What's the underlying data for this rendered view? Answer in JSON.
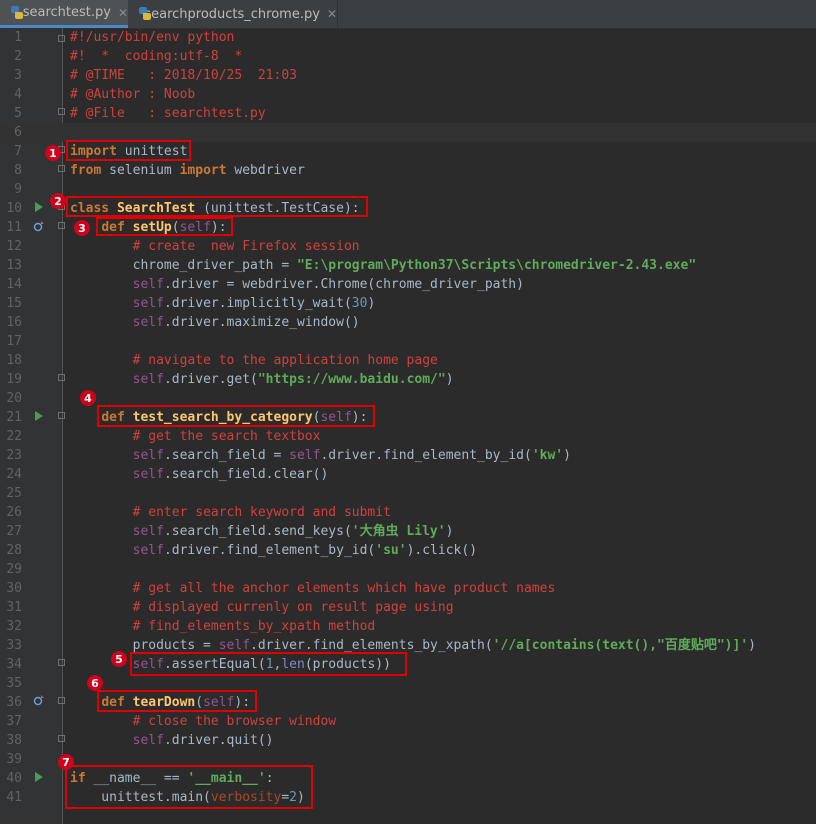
{
  "tabs": [
    {
      "label": "searchtest.py",
      "close": "✕",
      "active": true
    },
    {
      "label": "searchproducts_chrome.py",
      "close": "✕",
      "active": false
    }
  ],
  "editor": {
    "current_line": 6,
    "lines": [
      {
        "n": "1",
        "t": [
          [
            "cmt",
            "#!/usr/bin/env python"
          ]
        ]
      },
      {
        "n": "2",
        "t": [
          [
            "cmt",
            "#!  *  coding:utf-8  *"
          ]
        ]
      },
      {
        "n": "3",
        "t": [
          [
            "cmt",
            "# @TIME   : 2018/10/25  21:03"
          ]
        ]
      },
      {
        "n": "4",
        "t": [
          [
            "cmt",
            "# @Author : Noob"
          ]
        ]
      },
      {
        "n": "5",
        "t": [
          [
            "cmt",
            "# @File   : searchtest.py"
          ]
        ]
      },
      {
        "n": "6",
        "t": []
      },
      {
        "n": "7",
        "t": [
          [
            "kw",
            "import"
          ],
          [
            "p",
            " unittest"
          ]
        ]
      },
      {
        "n": "8",
        "t": [
          [
            "kw",
            "from"
          ],
          [
            "p",
            " selenium "
          ],
          [
            "kw",
            "import"
          ],
          [
            "p",
            " webdriver"
          ]
        ]
      },
      {
        "n": "9",
        "t": []
      },
      {
        "n": "10",
        "t": [
          [
            "kw",
            "class"
          ],
          [
            "p",
            " "
          ],
          [
            "fnm",
            "SearchTest"
          ],
          [
            "p",
            " (unittest.TestCase):"
          ]
        ]
      },
      {
        "n": "11",
        "t": [
          [
            "p",
            "    "
          ],
          [
            "kw",
            "def"
          ],
          [
            "p",
            " "
          ],
          [
            "fnm",
            "setUp"
          ],
          [
            "p",
            "("
          ],
          [
            "slf",
            "self"
          ],
          [
            "p",
            "):"
          ]
        ]
      },
      {
        "n": "12",
        "t": [
          [
            "p",
            "        "
          ],
          [
            "cmt",
            "# create  new Firefox session"
          ]
        ]
      },
      {
        "n": "13",
        "t": [
          [
            "p",
            "        chrome_driver_path = "
          ],
          [
            "str",
            "\"E:\\program\\Python37\\Scripts\\chromedriver-2.43.exe\""
          ]
        ]
      },
      {
        "n": "14",
        "t": [
          [
            "p",
            "        "
          ],
          [
            "slf",
            "self"
          ],
          [
            "p",
            ".driver = webdriver.Chrome(chrome_driver_path)"
          ]
        ]
      },
      {
        "n": "15",
        "t": [
          [
            "p",
            "        "
          ],
          [
            "slf",
            "self"
          ],
          [
            "p",
            ".driver.implicitly_wait("
          ],
          [
            "num",
            "30"
          ],
          [
            "p",
            ")"
          ]
        ]
      },
      {
        "n": "16",
        "t": [
          [
            "p",
            "        "
          ],
          [
            "slf",
            "self"
          ],
          [
            "p",
            ".driver.maximize_window()"
          ]
        ]
      },
      {
        "n": "17",
        "t": []
      },
      {
        "n": "18",
        "t": [
          [
            "p",
            "        "
          ],
          [
            "cmt",
            "# navigate to the application home page"
          ]
        ]
      },
      {
        "n": "19",
        "t": [
          [
            "p",
            "        "
          ],
          [
            "slf",
            "self"
          ],
          [
            "p",
            ".driver.get("
          ],
          [
            "str",
            "\"https://www.baidu.com/\""
          ],
          [
            "p",
            ")"
          ]
        ]
      },
      {
        "n": "20",
        "t": []
      },
      {
        "n": "21",
        "t": [
          [
            "p",
            "    "
          ],
          [
            "kw",
            "def"
          ],
          [
            "p",
            " "
          ],
          [
            "fnm",
            "test_search_by_category"
          ],
          [
            "p",
            "("
          ],
          [
            "slf",
            "self"
          ],
          [
            "p",
            "):"
          ]
        ]
      },
      {
        "n": "22",
        "t": [
          [
            "p",
            "        "
          ],
          [
            "cmt",
            "# get the search textbox"
          ]
        ]
      },
      {
        "n": "23",
        "t": [
          [
            "p",
            "        "
          ],
          [
            "slf",
            "self"
          ],
          [
            "p",
            ".search_field = "
          ],
          [
            "slf",
            "self"
          ],
          [
            "p",
            ".driver.find_element_by_id("
          ],
          [
            "str",
            "'kw'"
          ],
          [
            "p",
            ")"
          ]
        ]
      },
      {
        "n": "24",
        "t": [
          [
            "p",
            "        "
          ],
          [
            "slf",
            "self"
          ],
          [
            "p",
            ".search_field.clear()"
          ]
        ]
      },
      {
        "n": "25",
        "t": []
      },
      {
        "n": "26",
        "t": [
          [
            "p",
            "        "
          ],
          [
            "cmt",
            "# enter search keyword and submit"
          ]
        ]
      },
      {
        "n": "27",
        "t": [
          [
            "p",
            "        "
          ],
          [
            "slf",
            "self"
          ],
          [
            "p",
            ".search_field.send_keys("
          ],
          [
            "str",
            "'大角虫 Lily'"
          ],
          [
            "p",
            ")"
          ]
        ]
      },
      {
        "n": "28",
        "t": [
          [
            "p",
            "        "
          ],
          [
            "slf",
            "self"
          ],
          [
            "p",
            ".driver.find_element_by_id("
          ],
          [
            "str",
            "'su'"
          ],
          [
            "p",
            ").click()"
          ]
        ]
      },
      {
        "n": "29",
        "t": []
      },
      {
        "n": "30",
        "t": [
          [
            "p",
            "        "
          ],
          [
            "cmt",
            "# get all the anchor elements which have product names"
          ]
        ]
      },
      {
        "n": "31",
        "t": [
          [
            "p",
            "        "
          ],
          [
            "cmt",
            "# displayed currenly on result page using"
          ]
        ]
      },
      {
        "n": "32",
        "t": [
          [
            "p",
            "        "
          ],
          [
            "cmt",
            "# find_elements_by_xpath method"
          ]
        ]
      },
      {
        "n": "33",
        "t": [
          [
            "p",
            "        products = "
          ],
          [
            "slf",
            "self"
          ],
          [
            "p",
            ".driver.find_elements_by_xpath("
          ],
          [
            "str",
            "'//a[contains(text(),\"百度贴吧\")]'"
          ],
          [
            "p",
            ")"
          ]
        ]
      },
      {
        "n": "34",
        "t": [
          [
            "p",
            "        "
          ],
          [
            "slf",
            "self"
          ],
          [
            "p",
            ".assertEqual("
          ],
          [
            "num",
            "1"
          ],
          [
            "p",
            ","
          ],
          [
            "bi",
            "len"
          ],
          [
            "p",
            "(products))"
          ]
        ]
      },
      {
        "n": "35",
        "t": []
      },
      {
        "n": "36",
        "t": [
          [
            "p",
            "    "
          ],
          [
            "kw",
            "def"
          ],
          [
            "p",
            " "
          ],
          [
            "fnm",
            "tearDown"
          ],
          [
            "p",
            "("
          ],
          [
            "slf",
            "self"
          ],
          [
            "p",
            "):"
          ]
        ]
      },
      {
        "n": "37",
        "t": [
          [
            "p",
            "        "
          ],
          [
            "cmt",
            "# close the browser window"
          ]
        ]
      },
      {
        "n": "38",
        "t": [
          [
            "p",
            "        "
          ],
          [
            "slf",
            "self"
          ],
          [
            "p",
            ".driver.quit()"
          ]
        ]
      },
      {
        "n": "39",
        "t": []
      },
      {
        "n": "40",
        "t": [
          [
            "kw",
            "if"
          ],
          [
            "p",
            " __name__ == "
          ],
          [
            "str",
            "'__main__'"
          ],
          [
            "p",
            ":"
          ]
        ]
      },
      {
        "n": "41",
        "t": [
          [
            "p",
            "    unittest.main("
          ],
          [
            "prm",
            "verbosity"
          ],
          [
            "p",
            "="
          ],
          [
            "num",
            "2"
          ],
          [
            "p",
            ")"
          ]
        ]
      }
    ]
  },
  "annotations": [
    {
      "num": "1",
      "line": 7
    },
    {
      "num": "2",
      "line": 10
    },
    {
      "num": "3",
      "line": 11
    },
    {
      "num": "4",
      "line": 21
    },
    {
      "num": "5",
      "line": 34
    },
    {
      "num": "6",
      "line": 36
    },
    {
      "num": "7",
      "line": 40
    }
  ],
  "colors": {
    "annotation_red": "#e00000",
    "badge_red": "#d0021b",
    "run_green": "#499c54",
    "active_tab_underline": "#4a88c7"
  },
  "gutter_icons": {
    "run": "run-test-icon",
    "override": "override-method-icon",
    "fold": "fold-marker-icon"
  }
}
